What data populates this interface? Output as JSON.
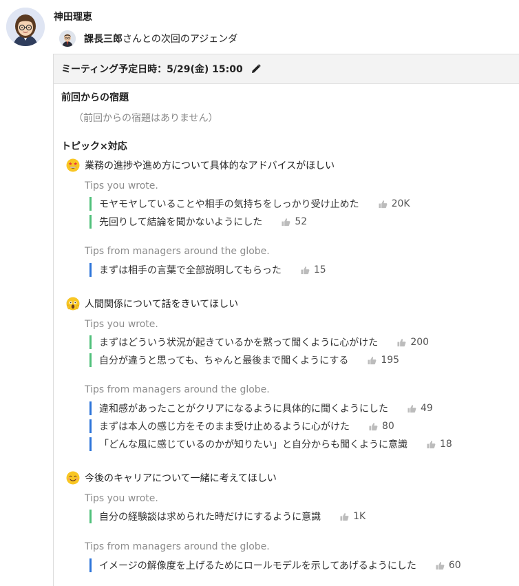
{
  "author": {
    "name": "神田理恵"
  },
  "recipient": {
    "name": "課長三郎",
    "suffix": "さんとの次回のアジェンダ"
  },
  "meeting": {
    "label": "ミーティング予定日時：5/29(金) 15:00"
  },
  "homework": {
    "title": "前回からの宿題",
    "empty_text": "（前回からの宿題はありません）"
  },
  "topics_title": "トピック×対応",
  "topics": [
    {
      "emoji": "star-struck-emoji",
      "title": "業務の進捗や進め方について具体的なアドバイスがほしい",
      "mine_label": "Tips you wrote.",
      "mine": [
        {
          "text": "モヤモヤしていることや相手の気持ちをしっかり受け止めた",
          "likes": "20K"
        },
        {
          "text": "先回りして結論を聞かないようにした",
          "likes": "52"
        }
      ],
      "global_label": "Tips from managers around the globe.",
      "global": [
        {
          "text": "まずは相手の言葉で全部説明してもらった",
          "likes": "15"
        }
      ]
    },
    {
      "emoji": "screaming-face-emoji",
      "title": "人間関係について話をきいてほしい",
      "mine_label": "Tips you wrote.",
      "mine": [
        {
          "text": "まずはどういう状況が起きているかを黙って聞くように心がけた",
          "likes": "200"
        },
        {
          "text": "自分が違うと思っても、ちゃんと最後まで聞くようにする",
          "likes": "195"
        }
      ],
      "global_label": "Tips from managers around the globe.",
      "global": [
        {
          "text": "違和感があったことがクリアになるように具体的に聞くようにした",
          "likes": "49"
        },
        {
          "text": "まずは本人の感じ方をそのまま受け止めるように心がけた",
          "likes": "80"
        },
        {
          "text": "「どんな風に感じているのかが知りたい」と自分からも聞くように意識",
          "likes": "18"
        }
      ]
    },
    {
      "emoji": "smiling-face-emoji",
      "title": "今後のキャリアについて一緒に考えてほしい",
      "mine_label": "Tips you wrote.",
      "mine": [
        {
          "text": "自分の経験談は求められた時だけにするように意識",
          "likes": "1K"
        }
      ],
      "global_label": "Tips from managers around the globe.",
      "global": [
        {
          "text": "イメージの解像度を上げるためにロールモデルを示してあげるようにした",
          "likes": "60"
        }
      ]
    }
  ],
  "colors": {
    "mine_bar": "#4fc07a",
    "global_bar": "#2c74d9",
    "muted_text": "#8c8c8c",
    "header_bg": "#f3f3f3"
  }
}
